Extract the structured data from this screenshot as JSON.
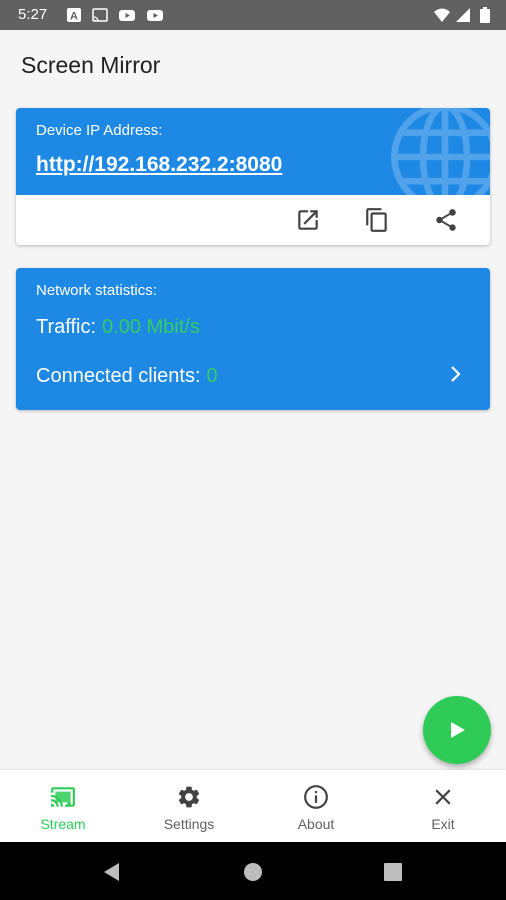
{
  "status_bar": {
    "time": "5:27",
    "left_icons": [
      "a-icon",
      "cast-icon",
      "youtube-icon",
      "youtube-icon"
    ],
    "right_icons": [
      "wifi-icon",
      "signal-icon",
      "battery-icon"
    ]
  },
  "app_bar": {
    "title": "Screen Mirror"
  },
  "ip_card": {
    "label": "Device IP Address:",
    "url": "http://192.168.232.2:8080",
    "actions": [
      "open-in-browser-icon",
      "copy-icon",
      "share-icon"
    ],
    "background_color": "#1e88e5"
  },
  "network_card": {
    "label": "Network statistics:",
    "traffic_label": "Traffic:",
    "traffic_value": "0.00 Mbit/s",
    "clients_label": "Connected clients:",
    "clients_value": "0",
    "value_color": "#33cc66"
  },
  "fab": {
    "icon": "play-icon",
    "color": "#2ecc56"
  },
  "bottom_nav": {
    "items": [
      {
        "label": "Stream",
        "icon": "cast-icon",
        "active": true
      },
      {
        "label": "Settings",
        "icon": "gear-icon",
        "active": false
      },
      {
        "label": "About",
        "icon": "info-icon",
        "active": false
      },
      {
        "label": "Exit",
        "icon": "close-icon",
        "active": false
      }
    ]
  },
  "system_nav": {
    "buttons": [
      "back-icon",
      "home-icon",
      "recents-icon"
    ]
  }
}
